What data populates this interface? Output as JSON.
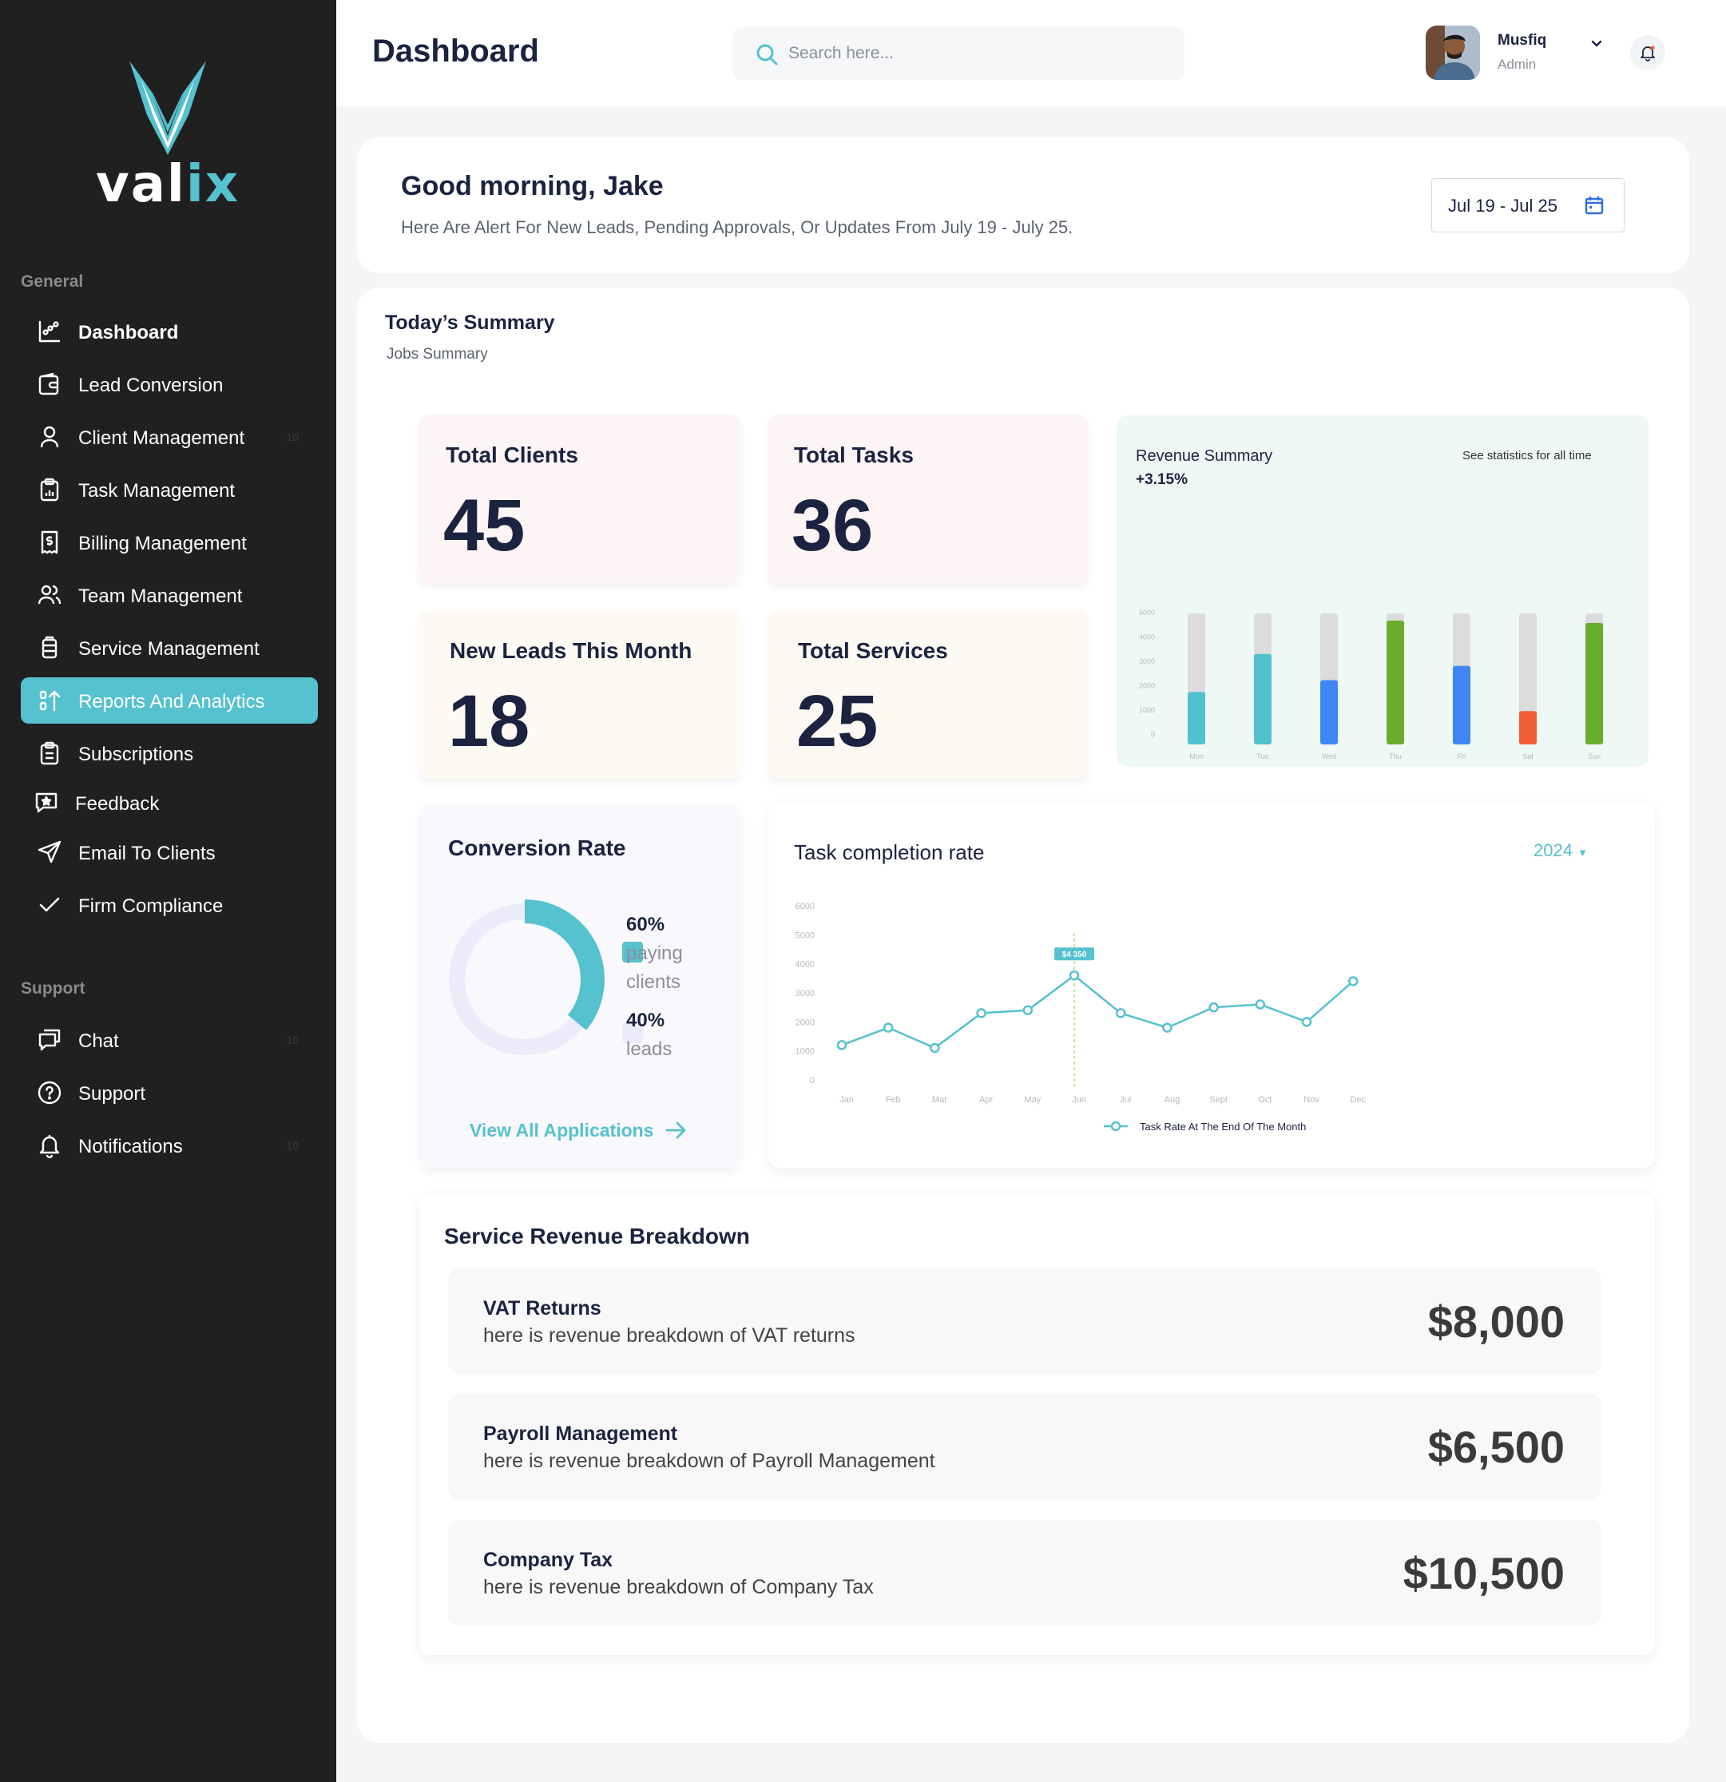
{
  "brand": {
    "name_left": "val",
    "name_right": "ix",
    "accent_color": "#56c1cf"
  },
  "sidebar": {
    "sections": {
      "general": "General",
      "support": "Support"
    },
    "general_items": [
      {
        "label": "Dashboard",
        "icon": "chart-icon",
        "count": ""
      },
      {
        "label": "Lead Conversion",
        "icon": "wallet-icon",
        "count": ""
      },
      {
        "label": "Client  Management",
        "icon": "user-icon",
        "count": "10"
      },
      {
        "label": "Task Management",
        "icon": "clipboard-chart-icon",
        "count": ""
      },
      {
        "label": "Billing Management",
        "icon": "invoice-dollar-icon",
        "count": ""
      },
      {
        "label": "Team Management",
        "icon": "users-icon",
        "count": ""
      },
      {
        "label": "Service Management",
        "icon": "service-icon",
        "count": ""
      },
      {
        "label": "Reports And Analytics",
        "icon": "sort-arrows-icon",
        "count": ""
      },
      {
        "label": "Subscriptions",
        "icon": "clipboard-list-icon",
        "count": ""
      },
      {
        "label": "Feedback",
        "icon": "feedback-star-icon",
        "count": ""
      },
      {
        "label": "Email To Clients",
        "icon": "send-icon",
        "count": ""
      },
      {
        "label": "Firm Compliance",
        "icon": "check-icon",
        "count": ""
      }
    ],
    "support_items": [
      {
        "label": "Chat",
        "icon": "chat-icon",
        "count": "10"
      },
      {
        "label": "Support",
        "icon": "help-icon",
        "count": ""
      },
      {
        "label": "Notifications",
        "icon": "bell-icon",
        "count": "10"
      }
    ]
  },
  "header": {
    "title": "Dashboard",
    "search_placeholder": "Search here...",
    "user": {
      "name": "Musfiq",
      "role": "Admin"
    }
  },
  "greeting": {
    "title": "Good morning, Jake",
    "subtitle": "Here Are Alert For New Leads, Pending Approvals, Or Updates From July 19 - July 25.",
    "date_range": "Jul 19 - Jul 25"
  },
  "summary": {
    "title": "Today’s Summary",
    "subtitle": "Jobs Summary",
    "stats": [
      {
        "label": "Total Clients",
        "value": "45"
      },
      {
        "label": "Total Tasks",
        "value": "36"
      },
      {
        "label": "New Leads This Month",
        "value": "18"
      },
      {
        "label": "Total Services",
        "value": "25"
      }
    ]
  },
  "conversion": {
    "title": "Conversion Rate",
    "legend": [
      {
        "pct": "60%",
        "line1": "paying",
        "line2": "clients"
      },
      {
        "pct": "40%",
        "line1": "leads",
        "line2": ""
      }
    ],
    "link": "View All Applications",
    "colors": {
      "paying": "#56c1cf",
      "leads": "#ecebfa"
    }
  },
  "breakdown": {
    "title": "Service Revenue Breakdown",
    "rows": [
      {
        "name": "VAT Returns",
        "desc": "here is revenue breakdown of VAT returns",
        "amount": "$8,000"
      },
      {
        "name": "Payroll Management",
        "desc": "here is revenue breakdown of Payroll Management",
        "amount": "$6,500"
      },
      {
        "name": "Company Tax",
        "desc": "here is revenue breakdown of Company Tax",
        "amount": "$10,500"
      }
    ]
  },
  "chart_data": [
    {
      "type": "bar",
      "title": "Revenue Summary",
      "subtitle": "+3.15%",
      "link": "See statistics for all time",
      "categories": [
        "Mon",
        "Tue",
        "Wed",
        "Thu",
        "Fri",
        "Sat",
        "Sun"
      ],
      "values": [
        2200,
        3800,
        2700,
        5200,
        3300,
        1400,
        5100
      ],
      "max": 5500,
      "bar_colors": [
        "#4fc1cf",
        "#4fc1cf",
        "#3f86f5",
        "#6aad2c",
        "#3f86f5",
        "#ef5d36",
        "#6aad2c"
      ],
      "track_color": "#dcdcdc",
      "y_ticks": [
        "5000",
        "4000",
        "3000",
        "2000",
        "1000",
        "0"
      ],
      "ylim": [
        0,
        5000
      ]
    },
    {
      "type": "line",
      "title": "Task completion rate",
      "year": "2024",
      "categories": [
        "Jan",
        "Feb",
        "Mar",
        "Apr",
        "May",
        "Jun",
        "Jul",
        "Aug",
        "Sept",
        "Oct",
        "Nov",
        "Dec"
      ],
      "series": [
        {
          "name": "Task Rate At The End Of The Month",
          "values": [
            1200,
            1800,
            1100,
            2300,
            2400,
            3600,
            2300,
            1800,
            2500,
            2600,
            2000,
            3400
          ],
          "color": "#56c1cf"
        }
      ],
      "y_ticks": [
        "6000",
        "5000",
        "4000",
        "3000",
        "2000",
        "1000",
        "0"
      ],
      "ylim": [
        0,
        6000
      ],
      "highlight": {
        "index": 5,
        "label": "$4 350"
      }
    }
  ]
}
